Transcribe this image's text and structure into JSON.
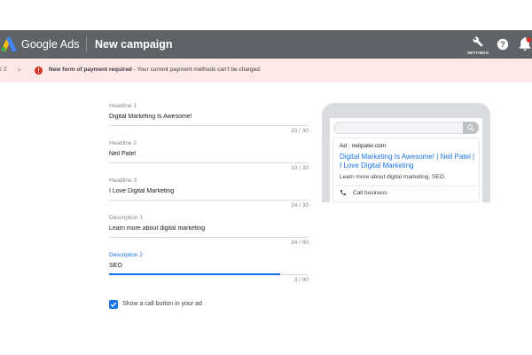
{
  "header": {
    "brand": "Google Ads",
    "page_title": "New campaign",
    "settings_label": "SETTINGS",
    "help_icon": "help-icon",
    "bell_icon": "notification-bell-icon"
  },
  "alert": {
    "pager": "/ 2",
    "pager_next": "›",
    "message_bold": "New form of payment required",
    "message_rest": " - Your current payment methods can't be charged."
  },
  "form": {
    "fields": [
      {
        "label": "Headline 1",
        "value": "Digital Marketing Is Awesome!",
        "count": "20 / 30"
      },
      {
        "label": "Headline 2",
        "value": "Neil Patel",
        "count": "10 / 30"
      },
      {
        "label": "Headline 3",
        "value": "I Love Digital Marketing",
        "count": "24 / 30"
      },
      {
        "label": "Description 1",
        "value": "Learn more about digital marketing",
        "count": "34 / 90"
      },
      {
        "label": "Description 2",
        "value": "SEO",
        "count": "3 / 90"
      }
    ],
    "call_checkbox_label": "Show a call button in your ad",
    "call_checkbox_checked": true
  },
  "preview": {
    "ad_label": "Ad · neilpatel.com",
    "title": "Digital Marketing Is Awesome! | Neil Patel | I Love Digital Marketing",
    "description": "Learn more about digital marketing. SEO.",
    "call_text": "Call business"
  },
  "colors": {
    "topbar": "#5f6368",
    "alert_bg": "#fce8e6",
    "alert_icon": "#d93025",
    "accent": "#1a73e8"
  }
}
